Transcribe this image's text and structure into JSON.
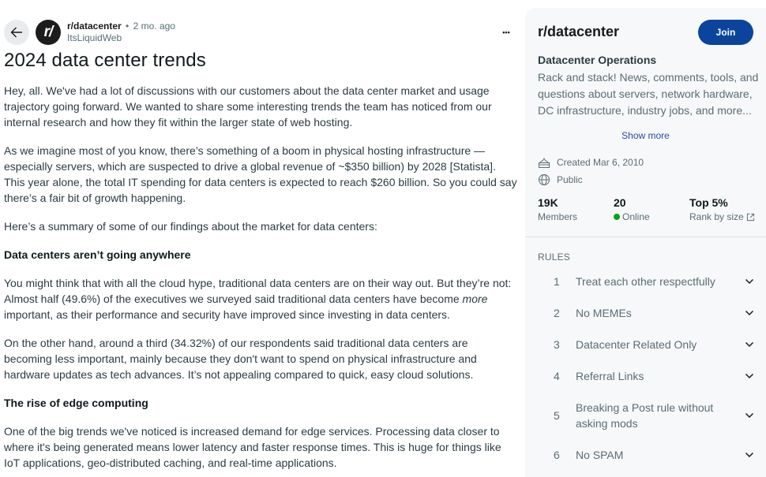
{
  "post": {
    "subreddit": "r/datacenter",
    "separator": "•",
    "time_ago": "2 mo. ago",
    "author": "ItsLiquidWeb",
    "avatar_text": "r/",
    "more_icon": "•••",
    "title": "2024 data center trends",
    "body": {
      "p1": "Hey, all. We've had a lot of discussions with our customers about the data center market and usage trajectory going forward. We wanted to share some interesting trends the team has noticed from our internal research and how they fit within the larger state of web hosting.",
      "p2": "As we imagine most of you know, there’s something of a boom in physical hosting infrastructure — especially servers, which are suspected to drive a global revenue of ~$350 billion) by 2028 [Statista]. This year alone, the total IT spending for data centers is expected to reach $260 billion. So you could say there’s a fair bit of growth happening.",
      "p3": "Here’s a summary of some of our findings about the market for data centers:",
      "h1": "Data centers aren’t going anywhere",
      "p4_before": "You might think that with all the cloud hype, traditional data centers are on their way out. But they’re not: Almost half (49.6%) of the executives we surveyed said traditional data centers have become ",
      "p4_em": "more",
      "p4_after": " important, as their performance and security have improved since investing in data centers.",
      "p5": "On the other hand, around a third (34.32%) of our respondents said traditional data centers are becoming less important, mainly because they don't want to spend on physical infrastructure and hardware updates as tech advances. It’s not appealing compared to quick, easy cloud solutions.",
      "h2": "The rise of edge computing",
      "p6": "One of the big trends we've noticed is increased demand for edge services. Processing data closer to where it's being generated means lower latency and faster response times. This is huge for things like IoT applications, geo-distributed caching, and real-time applications."
    }
  },
  "sidebar": {
    "title": "r/datacenter",
    "join_label": "Join",
    "subtitle": "Datacenter Operations",
    "description": "Rack and stack! News, comments, tools, and questions about servers, network hardware, DC infrastructure, industry jobs, and more...",
    "show_more": "Show more",
    "created": "Created Mar 6, 2010",
    "visibility": "Public",
    "stats": [
      {
        "value": "19K",
        "label": "Members"
      },
      {
        "value": "20",
        "label": "Online"
      },
      {
        "value": "Top 5%",
        "label": "Rank by size"
      }
    ],
    "rules_title": "RULES",
    "rules": [
      {
        "num": "1",
        "text": "Treat each other respectfully"
      },
      {
        "num": "2",
        "text": "No MEMEs"
      },
      {
        "num": "3",
        "text": "Datacenter Related Only"
      },
      {
        "num": "4",
        "text": "Referral Links"
      },
      {
        "num": "5",
        "text": "Breaking a Post rule without asking mods"
      },
      {
        "num": "6",
        "text": "No SPAM"
      }
    ]
  },
  "colors": {
    "join_button": "#0a449b",
    "online_dot": "#01a816",
    "link": "#2a4aa8",
    "sidebar_bg": "#f6f8f9"
  }
}
